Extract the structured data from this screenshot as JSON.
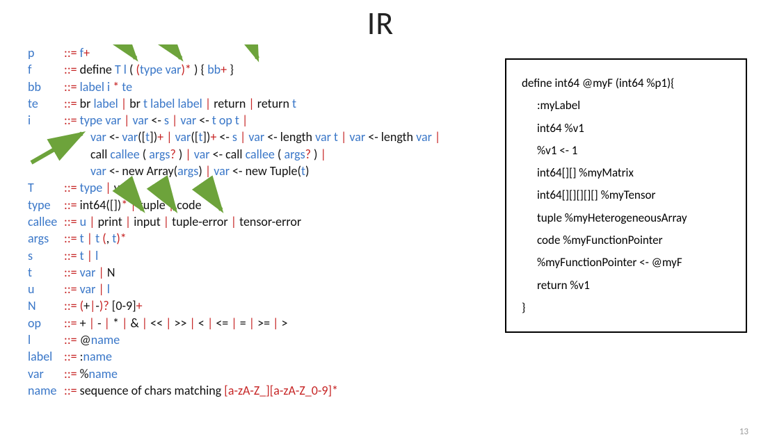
{
  "title": "IR",
  "slide_number": "13",
  "grammar": {
    "p": {
      "nt": "p",
      "rhs": [
        [
          "nt",
          "f"
        ],
        [
          "meta",
          "+"
        ]
      ]
    },
    "f": {
      "nt": "f",
      "rhs": [
        [
          "lit",
          "define "
        ],
        [
          "nt",
          "T"
        ],
        [
          "lit",
          " "
        ],
        [
          "nt",
          "l"
        ],
        [
          "lit",
          " ( "
        ],
        [
          "meta",
          "("
        ],
        [
          "nt",
          "type var"
        ],
        [
          "meta",
          ")*"
        ],
        [
          "lit",
          " ) { "
        ],
        [
          "nt",
          "bb"
        ],
        [
          "meta",
          "+ "
        ],
        [
          "lit",
          "}"
        ]
      ]
    },
    "bb": {
      "nt": "bb",
      "rhs": [
        [
          "nt",
          "label i "
        ],
        [
          "meta",
          "*"
        ],
        [
          "nt",
          " te"
        ]
      ]
    },
    "te": {
      "nt": "te",
      "rhs": [
        [
          "lit",
          "br "
        ],
        [
          "nt",
          "label"
        ],
        [
          "lit",
          "  "
        ],
        [
          "meta",
          "| "
        ],
        [
          "lit",
          "br "
        ],
        [
          "nt",
          "t label label"
        ],
        [
          "meta",
          " |"
        ],
        [
          "lit",
          " return "
        ],
        [
          "meta",
          "|"
        ],
        [
          "lit",
          " return "
        ],
        [
          "nt",
          "t"
        ]
      ]
    },
    "i": {
      "nt": "i",
      "rhs": [
        [
          "nt",
          "type var "
        ],
        [
          "meta",
          "| "
        ],
        [
          "nt",
          "var"
        ],
        [
          "lit",
          " <- "
        ],
        [
          "nt",
          "s"
        ],
        [
          "meta",
          " | "
        ],
        [
          "nt",
          "var"
        ],
        [
          "lit",
          " <- "
        ],
        [
          "nt",
          "t op t"
        ],
        [
          "meta",
          " |"
        ]
      ]
    },
    "i2": {
      "rhs": [
        [
          "nt",
          "var"
        ],
        [
          "lit",
          " <- "
        ],
        [
          "nt",
          "var"
        ],
        [
          "lit",
          "(["
        ],
        [
          "nt",
          "t"
        ],
        [
          "lit",
          "])"
        ],
        [
          "meta",
          "+ | "
        ],
        [
          "nt",
          "var"
        ],
        [
          "lit",
          "(["
        ],
        [
          "nt",
          "t"
        ],
        [
          "lit",
          "])"
        ],
        [
          "meta",
          "+"
        ],
        [
          "lit",
          " <- "
        ],
        [
          "nt",
          "s"
        ],
        [
          "meta",
          " | "
        ],
        [
          "nt",
          "var"
        ],
        [
          "lit",
          " <- length "
        ],
        [
          "nt",
          "var t"
        ],
        [
          "meta",
          " | "
        ],
        [
          "nt",
          "var"
        ],
        [
          "lit",
          " <- length "
        ],
        [
          "nt",
          "var"
        ],
        [
          "meta",
          " |"
        ]
      ]
    },
    "i3": {
      "rhs": [
        [
          "lit",
          "call "
        ],
        [
          "nt",
          "callee"
        ],
        [
          "lit",
          " ( "
        ],
        [
          "nt",
          "args"
        ],
        [
          "meta",
          "?"
        ],
        [
          "lit",
          " ) "
        ],
        [
          "meta",
          "|"
        ],
        [
          "nt",
          " var"
        ],
        [
          "lit",
          " <- call "
        ],
        [
          "nt",
          "callee"
        ],
        [
          "lit",
          " ( "
        ],
        [
          "nt",
          "args"
        ],
        [
          "meta",
          "?"
        ],
        [
          "lit",
          " ) "
        ],
        [
          "meta",
          "|"
        ]
      ]
    },
    "i4": {
      "rhs": [
        [
          "nt",
          " var"
        ],
        [
          "lit",
          " <- new Array("
        ],
        [
          "nt",
          "args"
        ],
        [
          "lit",
          ") "
        ],
        [
          "meta",
          "|"
        ],
        [
          "nt",
          " var"
        ],
        [
          "lit",
          " <- new Tuple("
        ],
        [
          "nt",
          "t"
        ],
        [
          "lit",
          ")"
        ]
      ]
    },
    "T": {
      "nt": "T",
      "rhs": [
        [
          "nt",
          "type"
        ],
        [
          "meta",
          " | "
        ],
        [
          "lit",
          "void"
        ]
      ]
    },
    "type": {
      "nt": "type",
      "rhs": [
        [
          "lit",
          "int64([])"
        ],
        [
          "meta",
          "* |"
        ],
        [
          "lit",
          " tuple "
        ],
        [
          "meta",
          "|"
        ],
        [
          "lit",
          " code"
        ]
      ]
    },
    "callee": {
      "nt": "callee",
      "rhs": [
        [
          "nt",
          "u "
        ],
        [
          "meta",
          "|"
        ],
        [
          "lit",
          " print "
        ],
        [
          "meta",
          "|"
        ],
        [
          "lit",
          " input "
        ],
        [
          "meta",
          "|"
        ],
        [
          "lit",
          " tuple-error "
        ],
        [
          "meta",
          "|"
        ],
        [
          "lit",
          " tensor-error"
        ]
      ]
    },
    "args": {
      "nt": "args",
      "rhs": [
        [
          "nt",
          "t "
        ],
        [
          "meta",
          "|"
        ],
        [
          "nt",
          " t "
        ],
        [
          "meta",
          "("
        ],
        [
          "lit",
          ","
        ],
        [
          "nt",
          " t"
        ],
        [
          "meta",
          ")*"
        ]
      ]
    },
    "s": {
      "nt": "s",
      "rhs": [
        [
          "nt",
          "t "
        ],
        [
          "meta",
          "|"
        ],
        [
          "nt",
          " l"
        ]
      ]
    },
    "t": {
      "nt": "t",
      "rhs": [
        [
          "nt",
          "var "
        ],
        [
          "meta",
          "|"
        ],
        [
          "lit",
          " N"
        ]
      ]
    },
    "u": {
      "nt": "u",
      "rhs": [
        [
          "nt",
          "var "
        ],
        [
          "meta",
          "|"
        ],
        [
          "nt",
          " l"
        ]
      ]
    },
    "N": {
      "nt": "N",
      "rhs": [
        [
          "meta",
          "("
        ],
        [
          "lit",
          "+"
        ],
        [
          "meta",
          "|"
        ],
        [
          "lit",
          "-"
        ],
        [
          "meta",
          ")?"
        ],
        [
          "lit",
          " [0-9]"
        ],
        [
          "meta",
          "+"
        ]
      ]
    },
    "op": {
      "nt": "op",
      "rhs": [
        [
          "lit",
          "+ "
        ],
        [
          "meta",
          "|"
        ],
        [
          "lit",
          " - "
        ],
        [
          "meta",
          "|"
        ],
        [
          "lit",
          " * "
        ],
        [
          "meta",
          "|"
        ],
        [
          "lit",
          " & "
        ],
        [
          "meta",
          "|"
        ],
        [
          "lit",
          " << "
        ],
        [
          "meta",
          "|"
        ],
        [
          "lit",
          " >> "
        ],
        [
          "meta",
          "|"
        ],
        [
          "lit",
          " < "
        ],
        [
          "meta",
          "|"
        ],
        [
          "lit",
          " <= "
        ],
        [
          "meta",
          "|"
        ],
        [
          "lit",
          " = "
        ],
        [
          "meta",
          "|"
        ],
        [
          "lit",
          " >= "
        ],
        [
          "meta",
          "|"
        ],
        [
          "lit",
          " >"
        ]
      ]
    },
    "l": {
      "nt": "l",
      "rhs": [
        [
          "lit",
          "@"
        ],
        [
          "nt",
          "name"
        ]
      ]
    },
    "label": {
      "nt": "label",
      "rhs": [
        [
          "lit",
          ":"
        ],
        [
          "nt",
          "name"
        ]
      ]
    },
    "var": {
      "nt": "var",
      "rhs": [
        [
          "lit",
          "%"
        ],
        [
          "nt",
          "name"
        ]
      ]
    },
    "name": {
      "nt": "name",
      "rhs": [
        [
          "lit",
          "sequence of chars matching "
        ],
        [
          "meta",
          "[a-zA-Z_][a-zA-Z_0-9]*"
        ]
      ]
    }
  },
  "code_example": {
    "line1": "define int64 @myF (int64 %p1){",
    "line2": ":myLabel",
    "line3": "int64 %v1",
    "line4": "%v1 <- 1",
    "line5": "int64[][] %myMatrix",
    "line6": "int64[][][][][] %myTensor",
    "line7": "tuple %myHeterogeneousArray",
    "line8": "code %myFunctionPointer",
    "line9": "%myFunctionPointer <- @myF",
    "line10": "return %v1",
    "line11": "}"
  }
}
